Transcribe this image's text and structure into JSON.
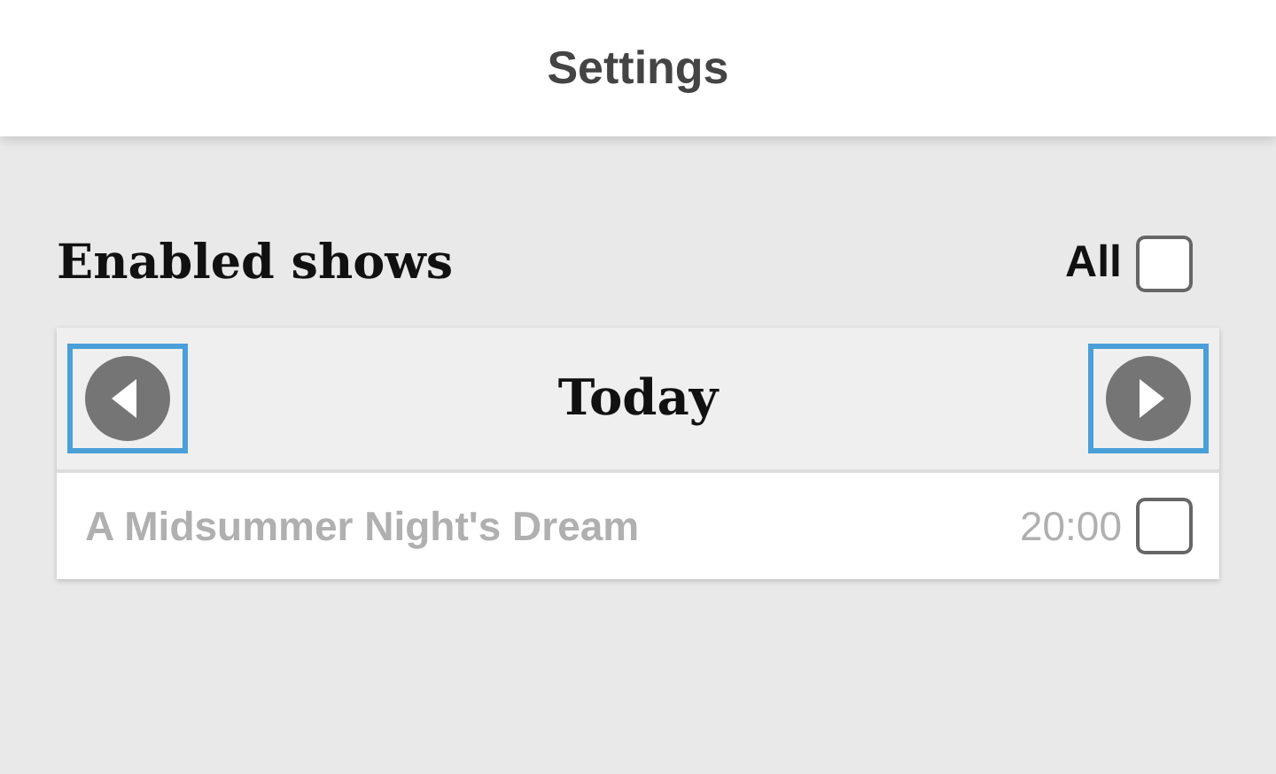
{
  "header": {
    "title": "Settings"
  },
  "section": {
    "title": "Enabled shows",
    "all_label": "All",
    "all_checked": false
  },
  "day_nav": {
    "label": "Today"
  },
  "shows": [
    {
      "title": "A Midsummer Night's Dream",
      "time": "20:00",
      "checked": false
    }
  ]
}
